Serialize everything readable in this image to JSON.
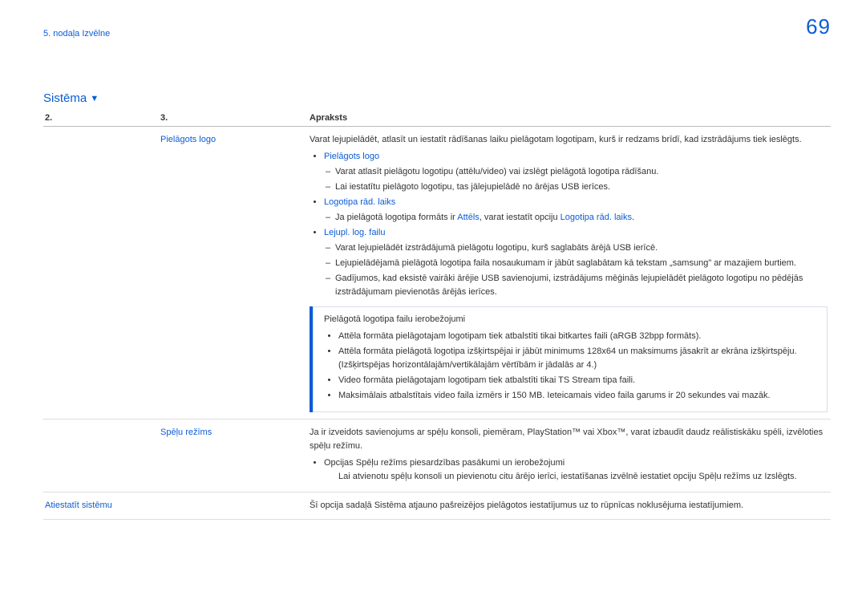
{
  "header": {
    "breadcrumb_prefix": "5. nodaļa",
    "breadcrumb_title": "Izvēlne",
    "page_number": "69"
  },
  "section": {
    "title": "Sistēma",
    "caret": "▼",
    "columns": {
      "c1": "2.",
      "c2": "3.",
      "c3": "Apraksts"
    }
  },
  "rows": [
    {
      "col2": "Pielāgots logo",
      "intro": "Varat lejupielādēt, atlasīt un iestatīt rādīšanas laiku pielāgotam logotipam, kurš ir redzams brīdī, kad izstrādājums tiek ieslēgts.",
      "items": [
        {
          "label": "Pielāgots logo",
          "dashes": [
            {
              "text": "Varat atlasīt pielāgotu logotipu (attēlu/video) vai izslēgt pielāgotā logotipa rādīšanu."
            },
            {
              "text": "Lai iestatītu pielāgoto logotipu, tas jālejupielādē no ārējas USB ierīces."
            }
          ]
        },
        {
          "label": "Logotipa rād. laiks",
          "dashes": [
            {
              "pre": "Ja pielāgotā logotipa formāts ir ",
              "link1": "Attēls",
              "mid": ", varat iestatīt opciju ",
              "link2": "Logotipa rād. laiks",
              "post": "."
            }
          ]
        },
        {
          "label": "Lejupl. log. failu",
          "dashes": [
            {
              "text": "Varat lejupielādēt izstrādājumā pielāgotu logotipu, kurš saglabāts ārējā USB ierīcē."
            },
            {
              "text": "Lejupielādējamā pielāgotā logotipa faila nosaukumam ir jābūt saglabātam kā tekstam „samsung\" ar mazajiem burtiem."
            },
            {
              "text": "Gadījumos, kad eksistē vairāki ārējie USB savienojumi, izstrādājums mēģinās lejupielādēt pielāgoto logotipu no pēdējās izstrādājumam pievienotās ārējās ierīces."
            }
          ]
        }
      ],
      "callout": {
        "title": "Pielāgotā logotipa failu ierobežojumi",
        "bullets": [
          "Attēla formāta pielāgotajam logotipam tiek atbalstīti tikai bitkartes faili (aRGB 32bpp formāts).",
          "Attēla formāta pielāgotā logotipa izšķirtspējai ir jābūt minimums 128x64 un maksimums jāsakrīt ar ekrāna izšķirtspēju. (Izšķirtspējas horizontālajām/vertikālajām vērtībām ir jādalās ar 4.)",
          "Video formāta pielāgotajam logotipam tiek atbalstīti tikai TS Stream tipa faili.",
          "Maksimālais atbalstītais video faila izmērs ir 150 MB. Ieteicamais video faila garums ir 20 sekundes vai mazāk."
        ]
      }
    },
    {
      "col2": "Spēļu režīms",
      "intro": "Ja ir izveidots savienojums ar spēļu konsoli, piemēram, PlayStation™ vai Xbox™, varat izbaudīt daudz reālistiskāku spēli, izvēloties spēļu režīmu.",
      "items": [
        {
          "plain_label": "Opcijas Spēļu režīms piesardzības pasākumi un ierobežojumi",
          "sub": "Lai atvienotu spēļu konsoli un pievienotu citu ārējo ierīci, iestatīšanas izvēlnē iestatiet opciju Spēļu režīms uz Izslēgts."
        }
      ]
    },
    {
      "col1": "Atiestatīt sistēmu",
      "desc": "Šī opcija sadaļā Sistēma atjauno pašreizējos pielāgotos iestatījumus uz to rūpnīcas noklusējuma iestatījumiem."
    }
  ]
}
